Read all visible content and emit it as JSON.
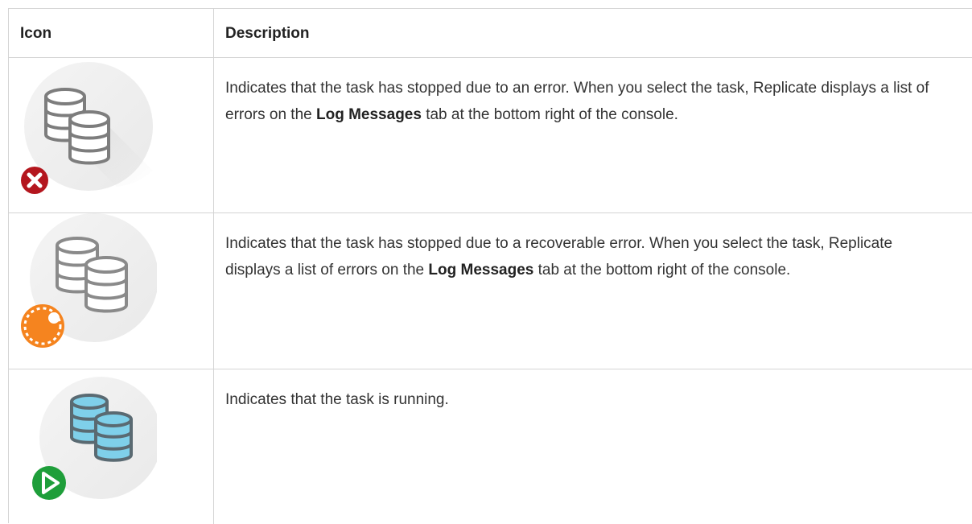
{
  "table": {
    "headers": {
      "icon": "Icon",
      "description": "Description"
    },
    "rows": [
      {
        "icon": "task-error-icon",
        "status_badge": "error-x-icon",
        "description_before": "Indicates that the task has stopped due to an error. When you select the task, Replicate displays a list of errors on the ",
        "description_bold": "Log Messages",
        "description_after": " tab at the bottom right of the console."
      },
      {
        "icon": "task-recoverable-error-icon",
        "status_badge": "recoverable-error-icon",
        "description_before": "Indicates that the task has stopped due to a recoverable error. When you select the task, Replicate displays a list of errors on the ",
        "description_bold": "Log Messages",
        "description_after": " tab at the bottom right of the console."
      },
      {
        "icon": "task-running-icon",
        "status_badge": "play-icon",
        "description_before": "Indicates that the task is running.",
        "description_bold": "",
        "description_after": ""
      }
    ]
  },
  "colors": {
    "error": "#b4161e",
    "recoverable": "#f5841f",
    "running": "#1e9e3a",
    "db_gray": "#8a8a8a",
    "db_blue": "#7fd0ea"
  }
}
